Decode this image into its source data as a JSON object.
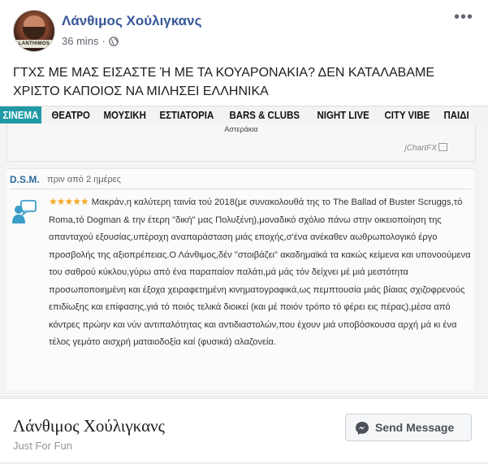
{
  "post": {
    "author": "Λάνθιμος Χούλιγκανς",
    "time": "36 mins",
    "separator": "·",
    "avatar_text": "LANTHIMOS",
    "more_menu": "•••",
    "text": "ΓΤΧΣ ΜΕ ΜΑΣ ΕΙΣΑΣΤΕ Ή ΜΕ ΤΑ ΚΟΥΑΡΟΝΑΚΙΑ? ΔΕΝ ΚΑΤΑΛΑΒΑΜΕ ΧΡΙΣΤΟ ΚΑΠΟΙΟΣ ΝΑ ΜΙΛΗΣΕΙ ΕΛΛΗΝΙΚΑ"
  },
  "embedded": {
    "nav_tabs": [
      "ΣΙΝΕΜΑ",
      "ΘΕΑΤΡΟ",
      "ΜΟΥΣΙΚΗ",
      "ΕΣΤΙΑΤΟΡΙΑ",
      "BARS & CLUBS",
      "NIGHT LIVE",
      "CITY VIBE",
      "ΠΑΙΔΙ"
    ],
    "chart_label": "Αστεράκια",
    "chart_brand": "jChartFX",
    "review": {
      "author": "D.S.M.",
      "time": "πριν από 2 ημέρες",
      "stars": "★★★★★",
      "rating": 5,
      "body": "Μακράν,η καλύτερη ταινία τού 2018(με συνακολουθά της το The Ballad of Buster Scruggs,τό Roma,τό Dogman & την έτερη \"δική\" μας Πολυξένη),μοναδικό σχόλιο πάνω στην οικειοποίηση της απανταχού εξουσίας,υπέροχη αναπαράσταση μιάς εποχής,σ'ένα ανέκαθεν αωθρωπολογικό έργο προσβολής της αξιοπρέπειας.Ο Λάνθιμος,δέν \"στοιβάζει\" ακαδημαϊκά τα κακώς κείμενα και υπονοούμενα του σαθρού κύκλου,γύρω από ένα παραπαίον παλάτι,μά μάς τόν δείχνει μέ μιά μεστότητα προσωποποιημένη και έξοχα χειραφετημένη κινηματογραφικά,ως πεμπτουσία μιάς βίαιας σχιζοφρενούς επιδίωξης και επίφασης,γιά τό ποιός τελικά διοικεί (και μέ ποιόν τρόπο τό φέρει εις πέρας),μέσα από κόντρες πρώην και νύν αντιπαλότητας και αντιδιαστολών,που έχουν μιά υποβόσκουσα αρχή μά κι ένα τέλος γεμάτο αισχρή ματαιοδοξία καί (φυσικά) αλαζονεία."
    }
  },
  "footer": {
    "page_name": "Λάνθιμος Χούλιγκανς",
    "category": "Just For Fun",
    "send_button": "Send Message"
  },
  "colors": {
    "link_blue": "#385898",
    "nav_first_bg": "#1f9aa5",
    "star": "#f5a623"
  }
}
